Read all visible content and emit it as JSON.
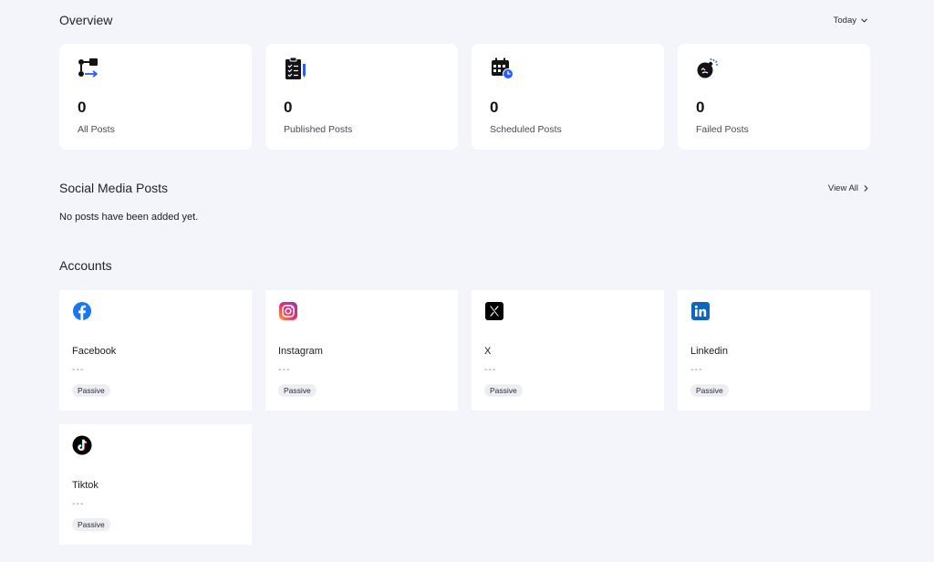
{
  "overview": {
    "title": "Overview",
    "period": "Today"
  },
  "stats": [
    {
      "value": "0",
      "label": "All Posts",
      "icon": "flow-icon"
    },
    {
      "value": "0",
      "label": "Published Posts",
      "icon": "checklist-icon"
    },
    {
      "value": "0",
      "label": "Scheduled Posts",
      "icon": "calendar-clock-icon"
    },
    {
      "value": "0",
      "label": "Failed Posts",
      "icon": "bomb-icon"
    }
  ],
  "posts": {
    "title": "Social Media Posts",
    "view_all": "View All",
    "empty": "No posts have been added yet."
  },
  "accounts": {
    "title": "Accounts",
    "items": [
      {
        "name": "Facebook",
        "detail": "---",
        "status": "Passive",
        "icon": "facebook-icon"
      },
      {
        "name": "Instagram",
        "detail": "---",
        "status": "Passive",
        "icon": "instagram-icon"
      },
      {
        "name": "X",
        "detail": "---",
        "status": "Passive",
        "icon": "x-icon"
      },
      {
        "name": "Linkedin",
        "detail": "---",
        "status": "Passive",
        "icon": "linkedin-icon"
      },
      {
        "name": "Tiktok",
        "detail": "---",
        "status": "Passive",
        "icon": "tiktok-icon"
      }
    ]
  },
  "colors": {
    "background": "#f4f5fa",
    "card": "#ffffff",
    "accent": "#2d5bff",
    "facebook": "#1877f2",
    "linkedin": "#0a66c2"
  }
}
